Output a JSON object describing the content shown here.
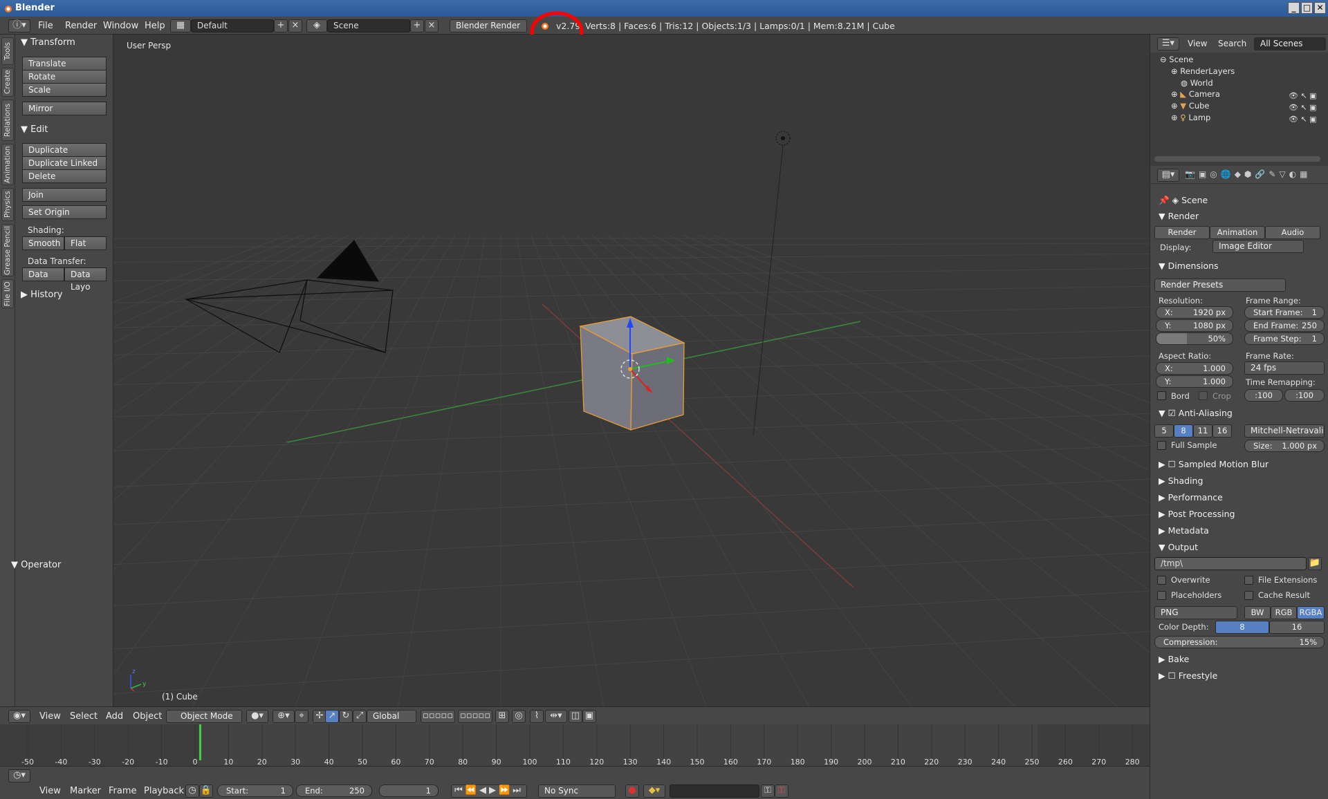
{
  "window": {
    "title": "Blender"
  },
  "menus": [
    "File",
    "Render",
    "Window",
    "Help"
  ],
  "layout": "Default",
  "scene": "Scene",
  "engine": "Blender Render",
  "version": "v2.79",
  "stats": "Verts:8 | Faces:6 | Tris:12 | Objects:1/3 | Lamps:0/1 | Mem:8.21M | Cube",
  "lefttabs": [
    "Tools",
    "Create",
    "Relations",
    "Animation",
    "Physics",
    "Grease Pencil",
    "File I/O"
  ],
  "toolshelf": {
    "transform": "Transform",
    "translate": "Translate",
    "rotate": "Rotate",
    "scale": "Scale",
    "mirror": "Mirror",
    "edit": "Edit",
    "duplicate": "Duplicate",
    "duplicate_linked": "Duplicate Linked",
    "delete": "Delete",
    "join": "Join",
    "set_origin": "Set Origin",
    "shading": "Shading:",
    "smooth": "Smooth",
    "flat": "Flat",
    "data_transfer": "Data Transfer:",
    "data": "Data",
    "data_layo": "Data Layo",
    "history": "History",
    "operator": "Operator"
  },
  "viewport": {
    "label": "User Persp",
    "object": "(1) Cube"
  },
  "vpheader": {
    "view": "View",
    "select": "Select",
    "add": "Add",
    "object": "Object",
    "mode": "Object Mode",
    "orientation": "Global"
  },
  "timeline": {
    "ticks": [
      "-50",
      "-40",
      "-30",
      "-20",
      "-10",
      "0",
      "10",
      "20",
      "30",
      "40",
      "50",
      "60",
      "70",
      "80",
      "90",
      "100",
      "110",
      "120",
      "130",
      "140",
      "150",
      "160",
      "170",
      "180",
      "190",
      "200",
      "210",
      "220",
      "230",
      "240",
      "250",
      "260",
      "270",
      "280"
    ]
  },
  "timeheader": {
    "view": "View",
    "marker": "Marker",
    "frame": "Frame",
    "playback": "Playback",
    "start": "Start:",
    "start_val": "1",
    "end": "End:",
    "end_val": "250",
    "current": "1",
    "sync": "No Sync"
  },
  "outliner": {
    "view": "View",
    "search": "Search",
    "filter": "All Scenes",
    "items": [
      "Scene",
      "RenderLayers",
      "World",
      "Camera",
      "Cube",
      "Lamp"
    ]
  },
  "props": {
    "context": "Scene",
    "render": "Render",
    "btn_render": "Render",
    "btn_animation": "Animation",
    "btn_audio": "Audio",
    "display": "Display:",
    "display_val": "Image Editor",
    "dimensions": "Dimensions",
    "presets": "Render Presets",
    "resolution": "Resolution:",
    "res_x_k": "X:",
    "res_x": "1920 px",
    "res_y_k": "Y:",
    "res_y": "1080 px",
    "res_pct": "50%",
    "frame_range": "Frame Range:",
    "start_k": "Start Frame:",
    "start": "1",
    "end_k": "End Frame:",
    "end": "250",
    "step_k": "Frame Step:",
    "step": "1",
    "aspect": "Aspect Ratio:",
    "asp_x_k": "X:",
    "asp_x": "1.000",
    "asp_y_k": "Y:",
    "asp_y": "1.000",
    "frame_rate": "Frame Rate:",
    "fps": "24 fps",
    "time_remap": "Time Remapping:",
    "remap_old": ":100",
    "remap_new": ":100",
    "bord": "Bord",
    "crop": "Crop",
    "aa": "Anti-Aliasing",
    "aa_levels": [
      "5",
      "8",
      "11",
      "16"
    ],
    "aa_filter": "Mitchell-Netravali",
    "full_sample": "Full Sample",
    "size_k": "Size:",
    "size": "1.000 px",
    "collapsed": [
      "Sampled Motion Blur",
      "Shading",
      "Performance",
      "Post Processing",
      "Metadata"
    ],
    "output": "Output",
    "path": "/tmp\\",
    "overwrite": "Overwrite",
    "file_ext": "File Extensions",
    "placeholders": "Placeholders",
    "cache": "Cache Result",
    "format": "PNG",
    "bw": "BW",
    "rgb": "RGB",
    "rgba": "RGBA",
    "color_depth": "Color Depth:",
    "depth8": "8",
    "depth16": "16",
    "compression_k": "Compression:",
    "compression": "15%",
    "bake": "Bake",
    "freestyle": "Freestyle"
  }
}
